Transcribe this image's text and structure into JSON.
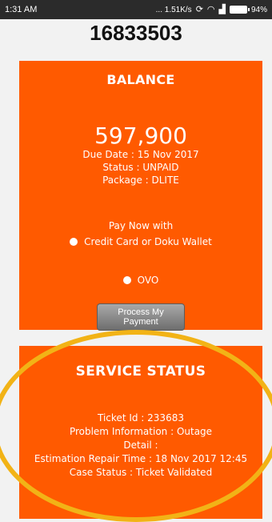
{
  "status_bar": {
    "time": "1:31 AM",
    "network_speed": "... 1.51K/s",
    "battery": "94%",
    "icons": [
      "sync-icon",
      "wifi-icon",
      "signal-icon",
      "battery-icon"
    ]
  },
  "account_number": "16833503",
  "balance_card": {
    "title": "BALANCE",
    "amount": "597,900",
    "due_date": "Due Date : 15 Nov 2017",
    "status": "Status : UNPAID",
    "package": "Package : DLITE",
    "pay_now": "Pay Now with",
    "options": [
      {
        "label": "Credit Card or Doku Wallet"
      },
      {
        "label": "OVO"
      }
    ],
    "process_button": "Process My Payment"
  },
  "service_card": {
    "title": "SERVICE STATUS",
    "ticket_id": "Ticket Id : 233683",
    "problem": "Problem Information : Outage",
    "detail": "Detail :",
    "estimation": "Estimation Repair Time : 18 Nov 2017 12:45",
    "case_status": "Case Status : Ticket Validated"
  },
  "colors": {
    "card": "#ff5a00",
    "highlight": "#f2b316",
    "background": "#f2f2f2"
  }
}
